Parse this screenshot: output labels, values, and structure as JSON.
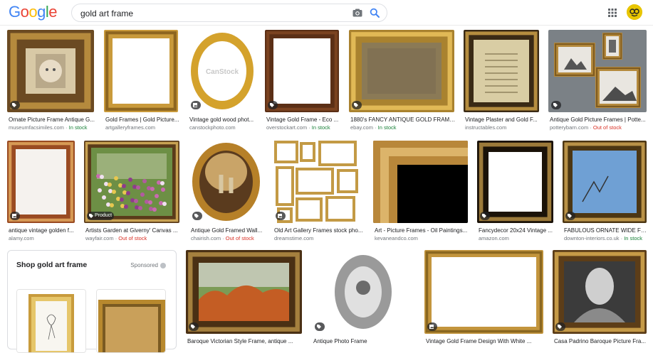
{
  "header": {
    "logo_letters": [
      {
        "ch": "G",
        "color": "#4285f4"
      },
      {
        "ch": "o",
        "color": "#ea4335"
      },
      {
        "ch": "o",
        "color": "#fbbc05"
      },
      {
        "ch": "g",
        "color": "#4285f4"
      },
      {
        "ch": "l",
        "color": "#34a853"
      },
      {
        "ch": "e",
        "color": "#ea4335"
      }
    ],
    "search_value": "gold art frame",
    "icons": [
      "camera-icon",
      "search-icon",
      "apps-grid-icon",
      "avatar"
    ]
  },
  "results": [
    {
      "title": "Ornate Picture Frame Antique G...",
      "source": "museumfacsimiles.com",
      "stock": "In stock",
      "stock_state": "in",
      "badge": "tag",
      "art": "baby"
    },
    {
      "title": "Gold Frames | Gold Picture...",
      "source": "artgalleryframes.com",
      "stock": "",
      "stock_state": "",
      "badge": "",
      "art": "plain"
    },
    {
      "title": "Vintage gold wood phot...",
      "source": "canstockphoto.com",
      "stock": "",
      "stock_state": "",
      "badge": "image",
      "art": "oval",
      "watermark": "CanStock"
    },
    {
      "title": "Vintage Gold Frame - Eco ...",
      "source": "overstockart.com",
      "stock": "In stock",
      "stock_state": "in",
      "badge": "tag",
      "art": "wood"
    },
    {
      "title": "1880's FANCY ANTIQUE GOLD FRAME ...",
      "source": "ebay.com",
      "stock": "In stock",
      "stock_state": "in",
      "badge": "tag",
      "art": "gilt"
    },
    {
      "title": "Vintage Plaster and Gold F...",
      "source": "instructables.com",
      "stock": "",
      "stock_state": "",
      "badge": "",
      "art": "document"
    },
    {
      "title": "Antique Gold Picture Frames | Potte...",
      "source": "potterybarn.com",
      "stock": "Out of stock",
      "stock_state": "out",
      "badge": "tag",
      "art": "wall"
    },
    {
      "title": "antique vintage golden f...",
      "source": "alamy.com",
      "stock": "",
      "stock_state": "",
      "badge": "image",
      "art": "tall"
    },
    {
      "title": "Artists Garden at Giverny' Canvas ...",
      "source": "wayfair.com",
      "stock": "Out of stock",
      "stock_state": "out",
      "badge": "product",
      "badge_label": "Product",
      "art": "garden"
    },
    {
      "title": "Antique Gold Framed Wall...",
      "source": "chairish.com",
      "stock": "Out of stock",
      "stock_state": "out",
      "badge": "tag",
      "art": "ovalpaint"
    },
    {
      "title": "Old Art Gallery Frames stock pho...",
      "source": "dreamstime.com",
      "stock": "",
      "stock_state": "",
      "badge": "image",
      "art": "collage"
    },
    {
      "title": "Art - Picture Frames - Oil Paintings...",
      "source": "kevaneandco.com",
      "stock": "",
      "stock_state": "",
      "badge": "",
      "art": "corner"
    },
    {
      "title": "Fancydecor 20x24 Vintage ...",
      "source": "amazon.com",
      "stock": "",
      "stock_state": "",
      "badge": "tag",
      "art": "ornate"
    },
    {
      "title": "FABULOUS ORNATE WIDE FRA...",
      "source": "downton-interiors.co.uk",
      "stock": "In stock",
      "stock_state": "in",
      "badge": "tag",
      "art": "sky"
    },
    {
      "title": "Baroque Victorian Style Frame, antique ...",
      "source": "",
      "stock": "",
      "stock_state": "",
      "badge": "tag",
      "art": "landscape"
    },
    {
      "title": "Antique Photo Frame",
      "source": "",
      "stock": "",
      "stock_state": "",
      "badge": "tag",
      "art": "silver"
    },
    {
      "title": "Vintage Gold Frame Design With White ...",
      "source": "",
      "stock": "",
      "stock_state": "",
      "badge": "image",
      "art": "white"
    },
    {
      "title": "Casa Padrino Baroque Picture Fra...",
      "source": "",
      "stock": "",
      "stock_state": "",
      "badge": "tag",
      "art": "portrait"
    }
  ],
  "shopping": {
    "title": "Shop gold art frame",
    "sponsored": "Sponsored"
  }
}
